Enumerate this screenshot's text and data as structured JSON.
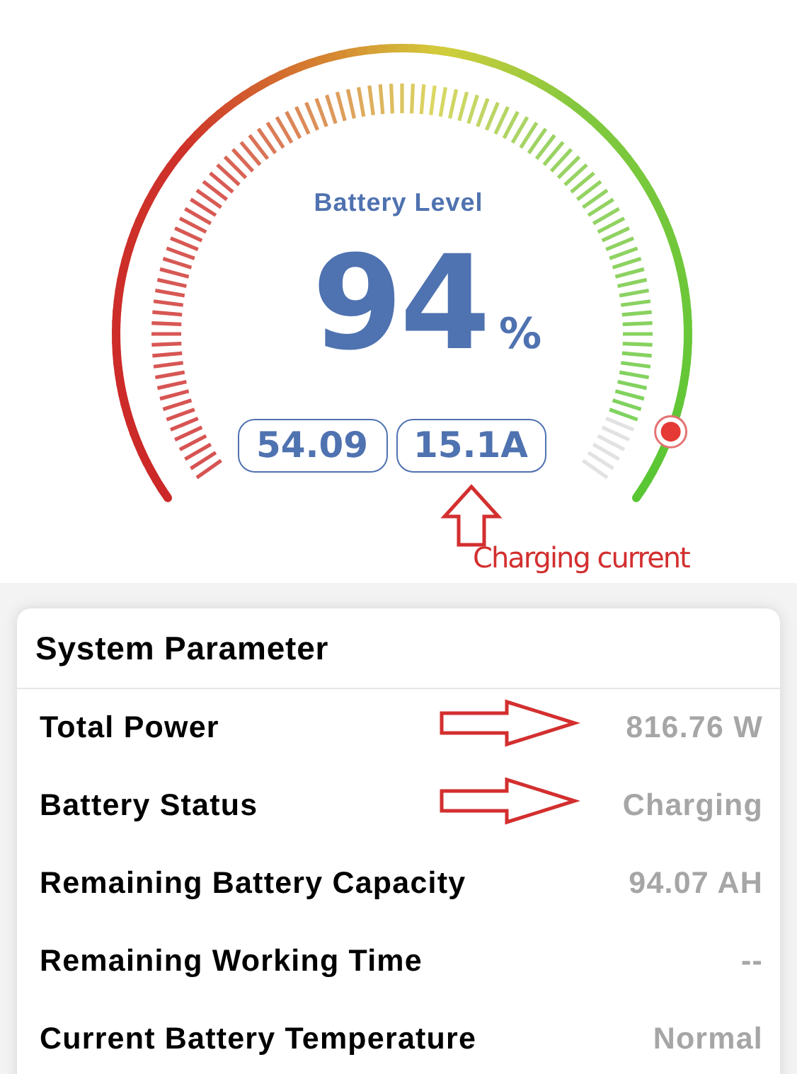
{
  "gauge": {
    "title": "Battery Level",
    "value": "94",
    "unit": "%",
    "readings": [
      "54.09",
      "15.1A"
    ],
    "callout": "Charging current"
  },
  "panel": {
    "title": "System Parameter",
    "rows": [
      {
        "label": "Total Power",
        "value": "816.76 W",
        "arrow": true
      },
      {
        "label": "Battery Status",
        "value": "Charging",
        "arrow": true
      },
      {
        "label": "Remaining Battery Capacity",
        "value": "94.07 AH",
        "arrow": false
      },
      {
        "label": "Remaining Working Time",
        "value": "--",
        "arrow": false
      },
      {
        "label": "Current Battery Temperature",
        "value": "Normal",
        "arrow": false
      }
    ]
  }
}
